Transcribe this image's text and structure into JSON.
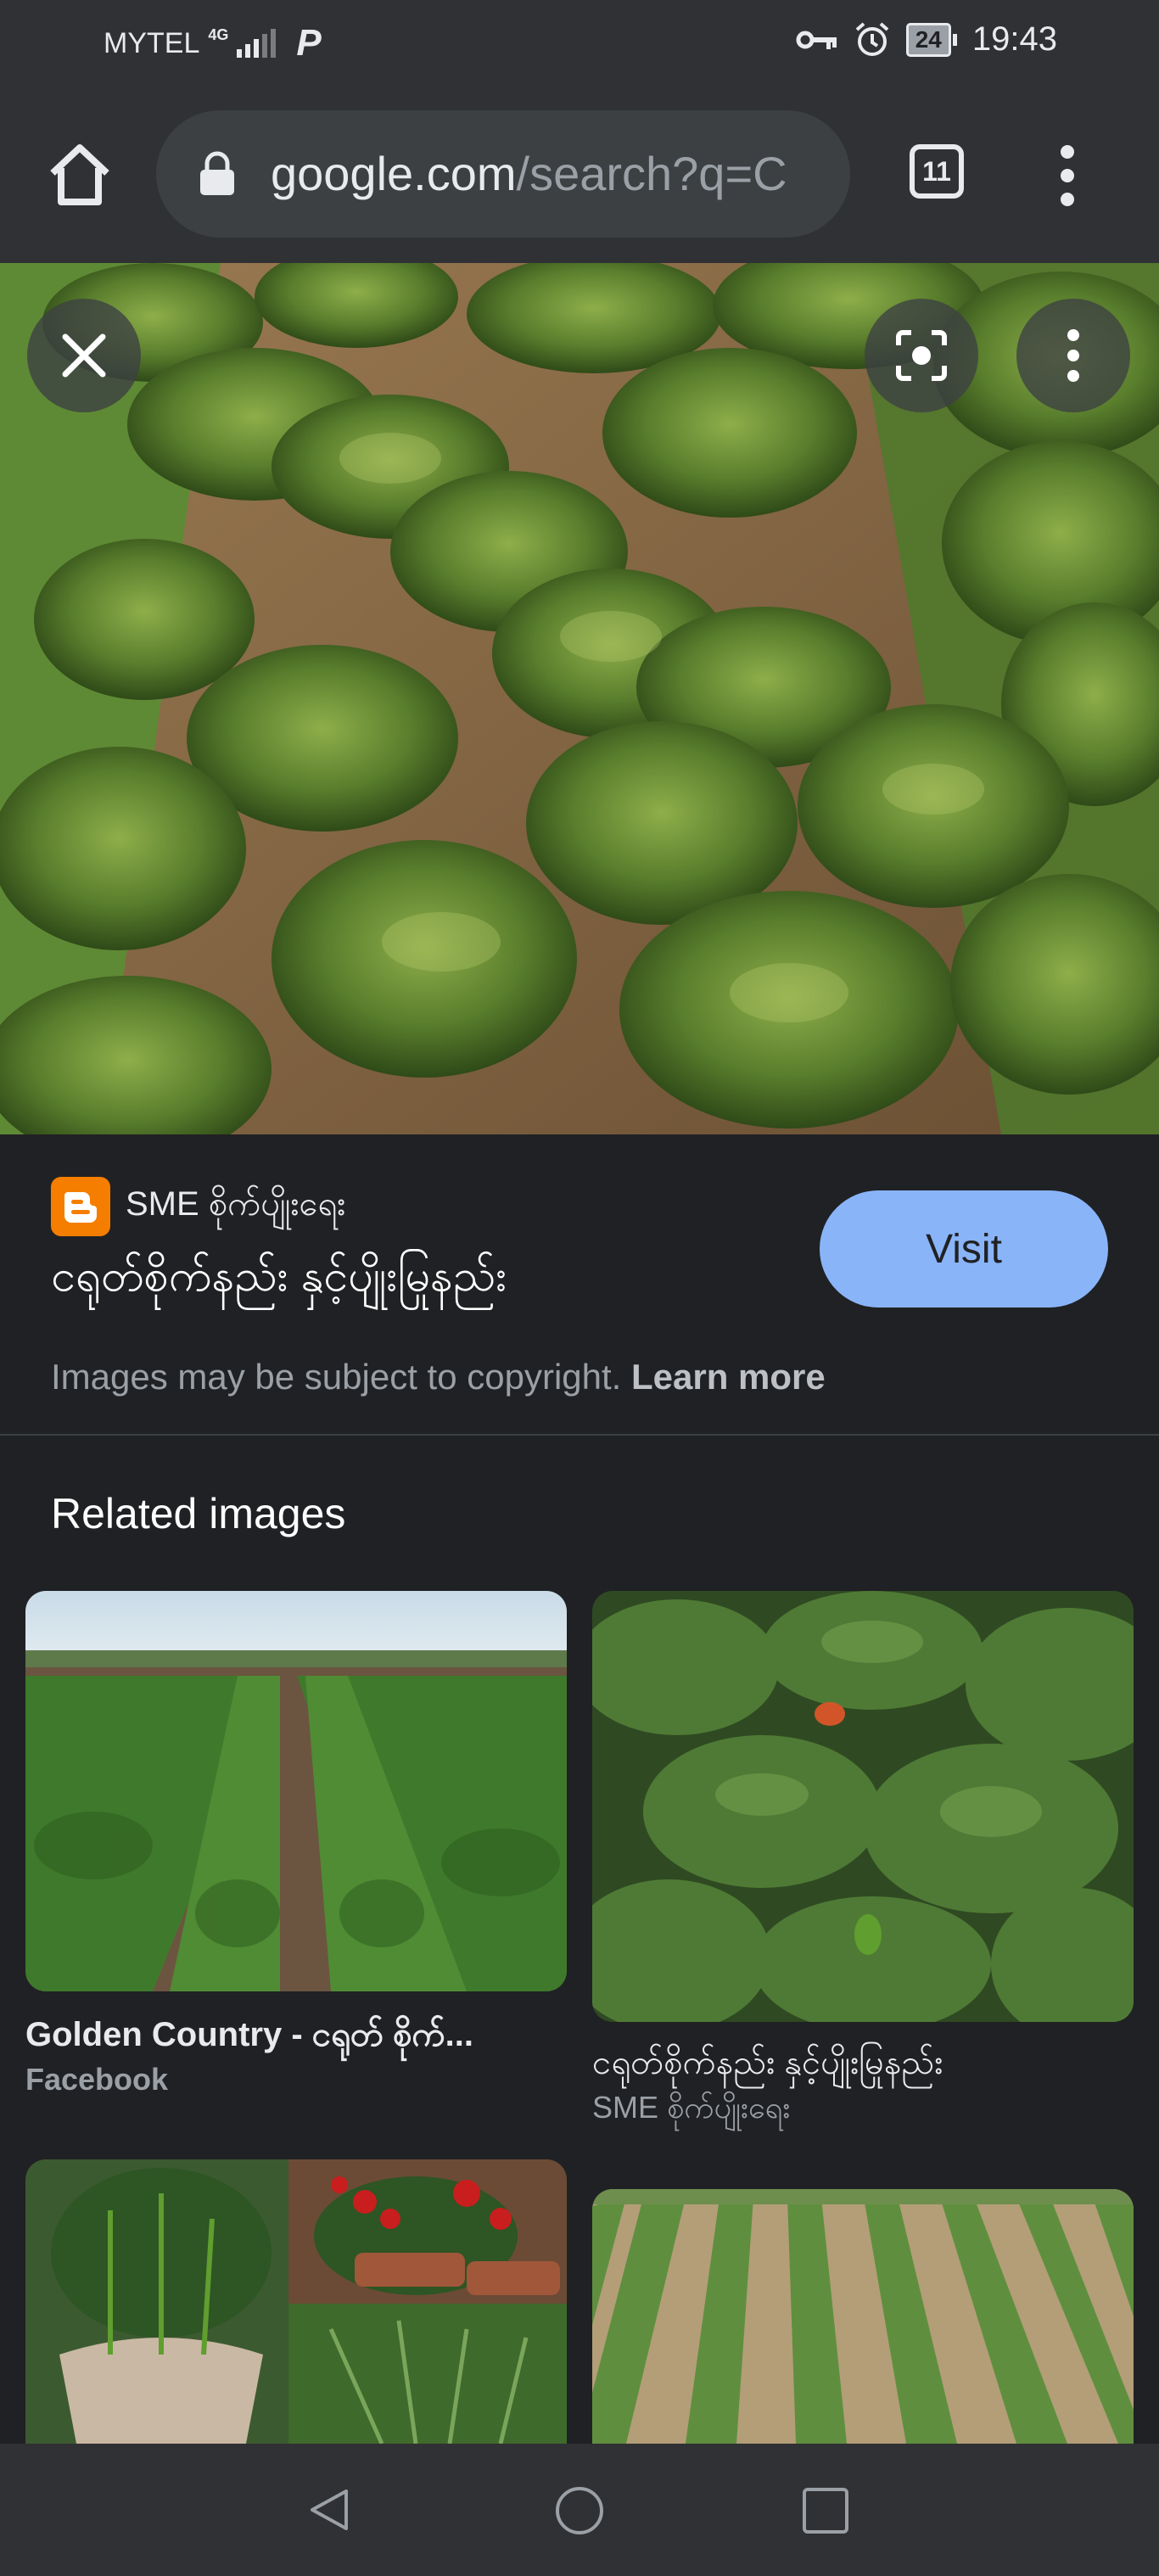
{
  "status_bar": {
    "carrier": "MYTEL",
    "network": "4G",
    "app_icon": "P",
    "battery": "24",
    "time": "19:43"
  },
  "browser": {
    "url_host": "google.com",
    "url_path": "/search?q=C",
    "tab_count": "11"
  },
  "result": {
    "site_name": "SME စိုက်ပျိုးရေး",
    "title": "ငရုတ်စိုက်နည်း နှင့်ပျိုးမြုနည်း",
    "visit_label": "Visit",
    "copyright_text": "Images may be subject to copyright.",
    "learn_more": "Learn more"
  },
  "related": {
    "heading": "Related images",
    "items": [
      {
        "title": "Golden Country - ငရုတ် စိုက်...",
        "source": "Facebook"
      },
      {
        "title": "ငရုတ်စိုက်နည်း နှင့်ပျိုးမြုနည်း",
        "source": "SME စိုက်ပျိုးရေး"
      }
    ]
  },
  "colors": {
    "background": "#202124",
    "toolbar": "#303134",
    "accent": "#8ab4f8",
    "blogger": "#f57d00"
  },
  "icons": [
    "home-icon",
    "lock-icon",
    "tab-switcher-icon",
    "more-vert-icon",
    "close-icon",
    "google-lens-icon",
    "blogger-icon",
    "back-icon",
    "home-nav-icon",
    "recents-icon"
  ]
}
